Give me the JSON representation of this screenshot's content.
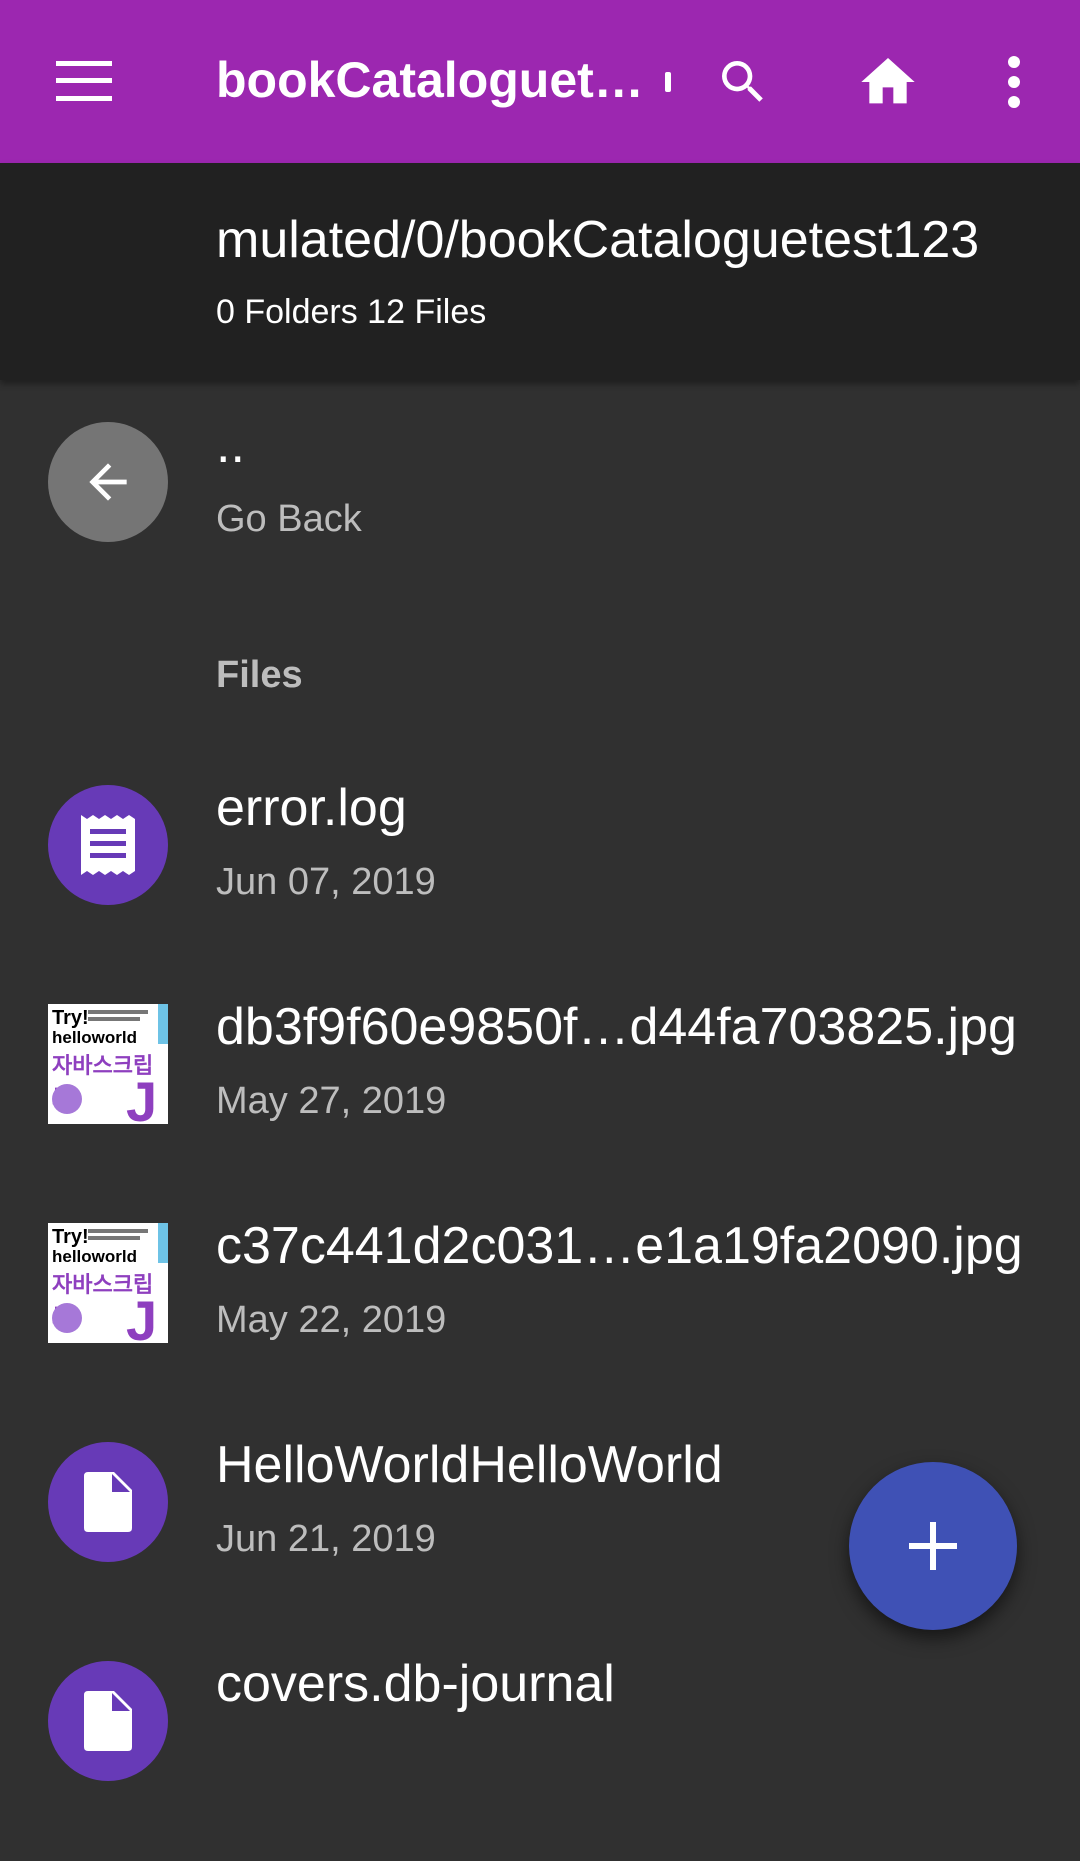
{
  "app_bar": {
    "title": "bookCataloguet…",
    "background": "#9c27b0",
    "icons": [
      "menu-icon",
      "search-icon",
      "home-icon",
      "more-vert-icon"
    ]
  },
  "path_bar": {
    "path": "mulated/0/bookCataloguetest123",
    "counts": "0 Folders 12 Files"
  },
  "back_item": {
    "name": "..",
    "subtitle": "Go Back",
    "icon": "arrow-back-icon"
  },
  "sections": {
    "files_header": "Files"
  },
  "files": [
    {
      "name": "error.log",
      "date": "Jun 07, 2019",
      "icon": "text-file-icon",
      "color": "#673ab7"
    },
    {
      "name": "db3f9f60e9850f…d44fa703825.jpg",
      "date": "May 27, 2019",
      "icon": "image-thumbnail",
      "thumb_text": {
        "try": "Try!",
        "hello": "helloworld",
        "ko": "자바스크립트",
        "j": "J"
      }
    },
    {
      "name": "c37c441d2c031…e1a19fa2090.jpg",
      "date": "May 22, 2019",
      "icon": "image-thumbnail",
      "thumb_text": {
        "try": "Try!",
        "hello": "helloworld",
        "ko": "자바스크립트",
        "j": "J"
      }
    },
    {
      "name": "HelloWorldHelloWorld",
      "date": "Jun 21, 2019",
      "icon": "file-icon",
      "color": "#673ab7"
    },
    {
      "name": "covers.db-journal",
      "date": "",
      "icon": "file-icon",
      "color": "#673ab7"
    }
  ],
  "fab": {
    "icon": "add-icon",
    "color": "#3f51b5"
  }
}
